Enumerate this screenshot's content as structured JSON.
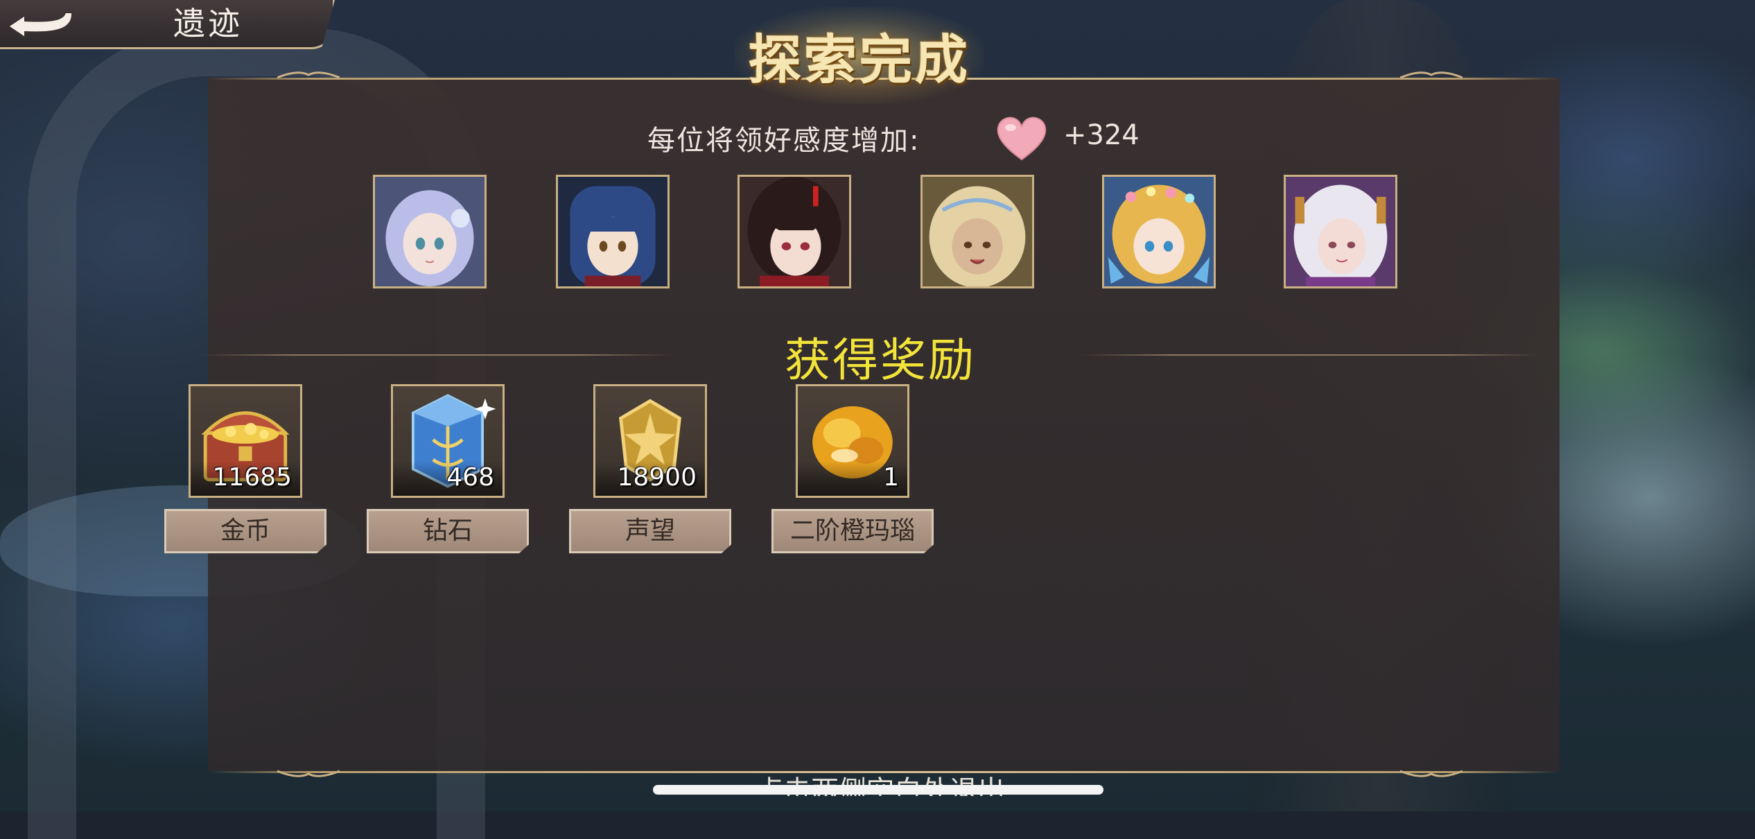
{
  "nav": {
    "title": "遗迹"
  },
  "header": {
    "title": "探索完成"
  },
  "favor": {
    "label": "每位将领好感度增加:",
    "value": "+324"
  },
  "heroes": [
    {
      "name": "hero-1",
      "hair": "#b9bde8",
      "skin": "#f3e2dc"
    },
    {
      "name": "hero-2",
      "hair": "#2e4a86",
      "skin": "#f4e0cf"
    },
    {
      "name": "hero-3",
      "hair": "#2a1b1a",
      "skin": "#f3ddd3"
    },
    {
      "name": "hero-4",
      "hair": "#e4d2a4",
      "skin": "#d8b796"
    },
    {
      "name": "hero-5",
      "hair": "#e7b64f",
      "skin": "#f6e3d5"
    },
    {
      "name": "hero-6",
      "hair": "#e9e6ef",
      "skin": "#f3dcd5"
    }
  ],
  "rewards": {
    "title": "获得奖励",
    "items": [
      {
        "label": "金币",
        "count": "11685",
        "icon": "treasure-chest-icon"
      },
      {
        "label": "钻石",
        "count": "468",
        "icon": "diamond-crystal-icon"
      },
      {
        "label": "声望",
        "count": "18900",
        "icon": "prestige-badge-icon"
      },
      {
        "label": "二阶橙玛瑙",
        "count": "1",
        "icon": "orange-agate-icon"
      }
    ]
  },
  "footer": {
    "hint": "点击两侧空白处退出"
  },
  "colors": {
    "gold_border": "#c9b083",
    "reward_title": "#f3e43a",
    "heart": "#f2aab8"
  }
}
